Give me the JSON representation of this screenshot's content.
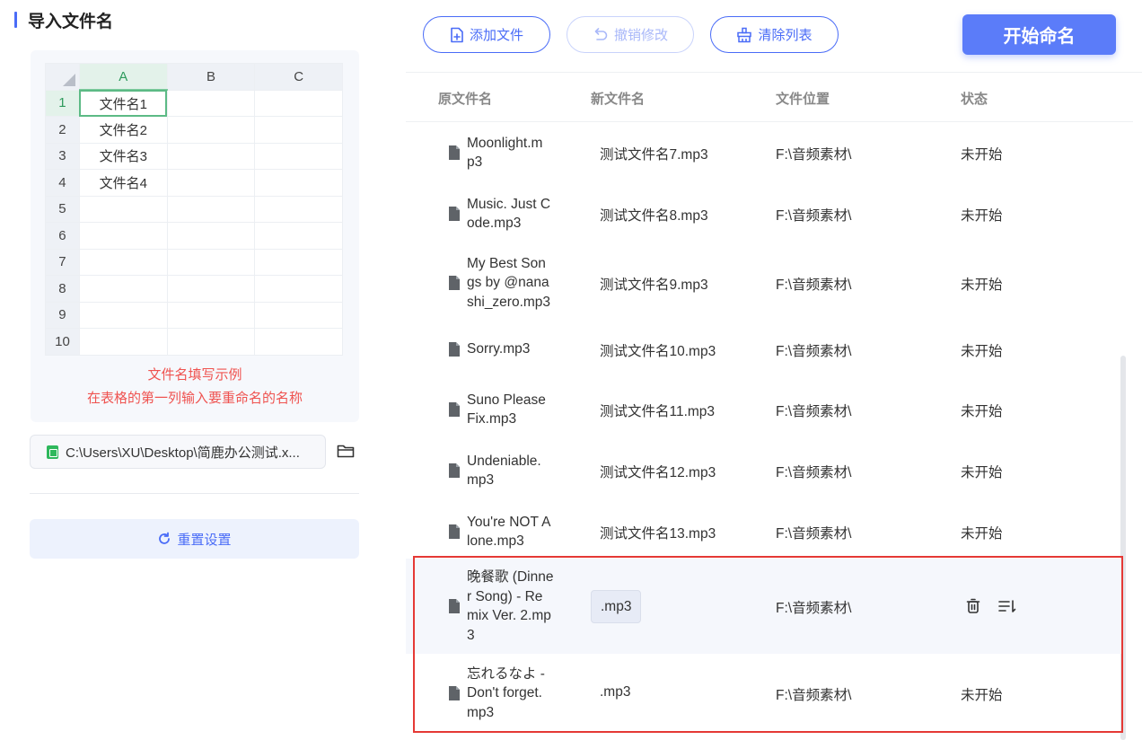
{
  "left_panel": {
    "title": "导入文件名",
    "sheet": {
      "columns": [
        "A",
        "B",
        "C"
      ],
      "rows": [
        {
          "num": "1",
          "a": "文件名1"
        },
        {
          "num": "2",
          "a": "文件名2"
        },
        {
          "num": "3",
          "a": "文件名3"
        },
        {
          "num": "4",
          "a": "文件名4"
        },
        {
          "num": "5",
          "a": ""
        },
        {
          "num": "6",
          "a": ""
        },
        {
          "num": "7",
          "a": ""
        },
        {
          "num": "8",
          "a": ""
        },
        {
          "num": "9",
          "a": ""
        },
        {
          "num": "10",
          "a": ""
        }
      ]
    },
    "hint_line1": "文件名填写示例",
    "hint_line2": "在表格的第一列输入要重命名的名称",
    "file_path": "C:\\Users\\XU\\Desktop\\简鹿办公测试.x...",
    "reset_label": "重置设置"
  },
  "toolbar": {
    "add_label": "添加文件",
    "undo_label": "撤销修改",
    "clear_label": "清除列表",
    "start_label": "开始命名"
  },
  "table": {
    "headers": {
      "original": "原文件名",
      "new": "新文件名",
      "location": "文件位置",
      "status": "状态"
    },
    "rows": [
      {
        "orig": [
          "Moonlight.m",
          "p3"
        ],
        "new": "测试文件名7.mp3",
        "loc": "F:\\音频素材\\",
        "status": "未开始"
      },
      {
        "orig": [
          "Music. Just C",
          "ode.mp3"
        ],
        "new": "测试文件名8.mp3",
        "loc": "F:\\音频素材\\",
        "status": "未开始"
      },
      {
        "orig": [
          "My Best Son",
          "gs by @nana",
          "shi_zero.mp3"
        ],
        "new": "测试文件名9.mp3",
        "loc": "F:\\音频素材\\",
        "status": "未开始"
      },
      {
        "orig": [
          "Sorry.mp3"
        ],
        "new": "测试文件名10.mp3",
        "loc": "F:\\音频素材\\",
        "status": "未开始"
      },
      {
        "orig": [
          "Suno Please",
          "Fix.mp3"
        ],
        "new": "测试文件名11.mp3",
        "loc": "F:\\音频素材\\",
        "status": "未开始"
      },
      {
        "orig": [
          "Undeniable.",
          "mp3"
        ],
        "new": "测试文件名12.mp3",
        "loc": "F:\\音频素材\\",
        "status": "未开始"
      },
      {
        "orig": [
          "You're NOT A",
          "lone.mp3"
        ],
        "new": "测试文件名13.mp3",
        "loc": "F:\\音频素材\\",
        "status": "未开始"
      },
      {
        "orig": [
          "晚餐歌 (Dinne",
          "r Song) - Re",
          "mix Ver. 2.mp",
          "3"
        ],
        "new": ".mp3",
        "loc": "F:\\音频素材\\",
        "status": ""
      },
      {
        "orig": [
          "忘れるなよ -",
          "Don't forget.",
          "mp3"
        ],
        "new": ".mp3",
        "loc": "F:\\音频素材\\",
        "status": "未开始"
      }
    ]
  },
  "colors": {
    "accent": "#4a6cf7",
    "hint_red": "#ef5350",
    "frame_red": "#e53935",
    "excel_green": "#2eb85c"
  }
}
